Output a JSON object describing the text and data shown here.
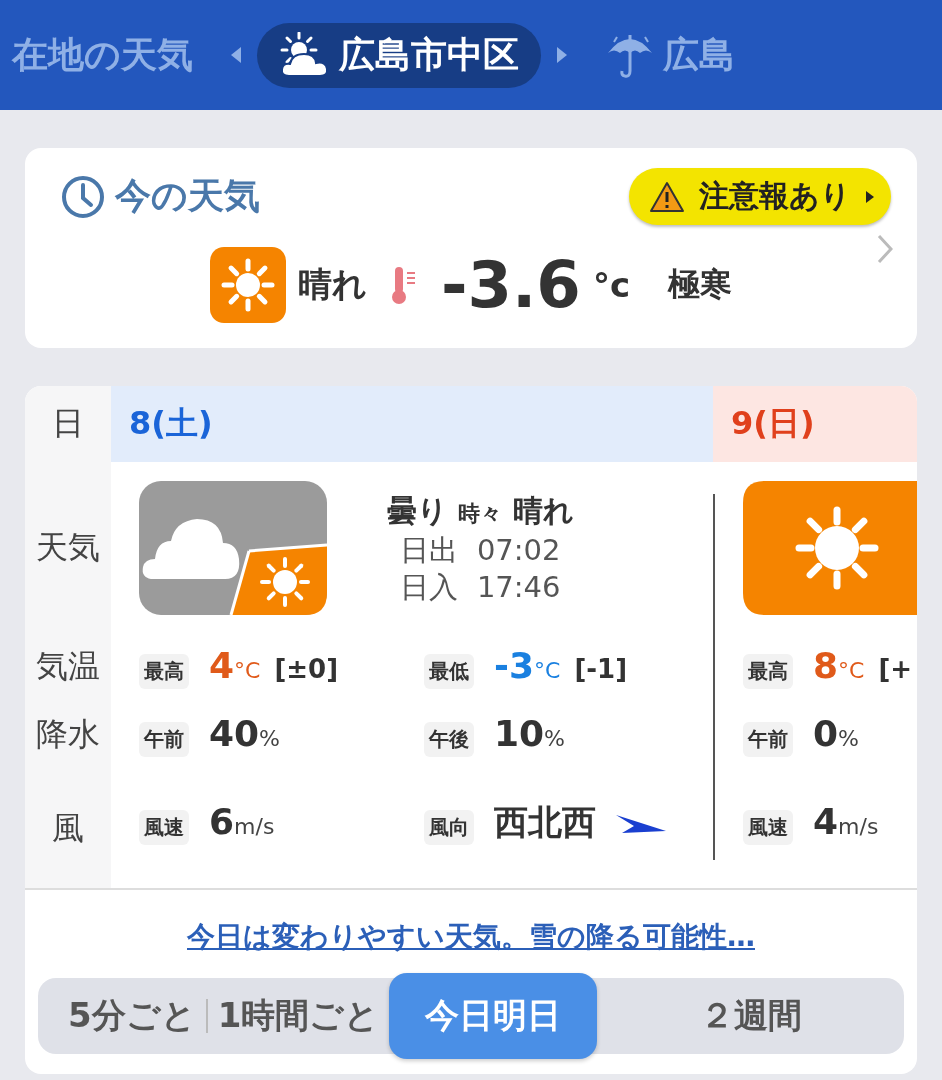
{
  "location_tabs": [
    {
      "label": "在地の天気",
      "kind": "plain",
      "selected": false
    },
    {
      "label": "広島市中区",
      "kind": "partly",
      "selected": true
    },
    {
      "label": "広島",
      "kind": "rain",
      "selected": false
    }
  ],
  "current": {
    "title": "今の天気",
    "alert": "注意報あり",
    "condition": "晴れ",
    "temperature": "-3.6",
    "unit": "°c",
    "feel": "極寒"
  },
  "forecast": {
    "row_labels": [
      "日",
      "天気",
      "気温",
      "降水",
      "風"
    ],
    "days": [
      {
        "date": "8(土)",
        "kind": "saturday",
        "condition": "曇り",
        "connector": "時々",
        "condition2": "晴れ",
        "sunrise_label": "日出",
        "sunrise": "07:02",
        "sunset_label": "日入",
        "sunset": "17:46",
        "temps": [
          {
            "label": "最高",
            "value": "4",
            "unit": "°C",
            "diff": "[±0]",
            "kind": "high"
          },
          {
            "label": "最低",
            "value": "-3",
            "unit": "°C",
            "diff": "[-1]",
            "kind": "low"
          }
        ],
        "precip": [
          {
            "label": "午前",
            "value": "40",
            "unit": "%"
          },
          {
            "label": "午後",
            "value": "10",
            "unit": "%"
          }
        ],
        "wind": [
          {
            "label": "風速",
            "value": "6",
            "unit": "m/s",
            "kind": "speed"
          },
          {
            "label": "風向",
            "value": "西北西",
            "kind": "direction"
          }
        ]
      },
      {
        "date": "9(日)",
        "kind": "sunday",
        "temps": [
          {
            "label": "最高",
            "value": "8",
            "unit": "°C",
            "diff": "[+",
            "kind": "high"
          }
        ],
        "precip": [
          {
            "label": "午前",
            "value": "0",
            "unit": "%"
          }
        ],
        "wind": [
          {
            "label": "風速",
            "value": "4",
            "unit": "m/s",
            "kind": "speed"
          }
        ]
      }
    ]
  },
  "summary_link": "今日は変わりやすい天気。雪の降る可能性…",
  "view_tabs": [
    {
      "label": "5分ごと",
      "selected": false
    },
    {
      "label": "1時間ごと",
      "selected": false
    },
    {
      "label": "今日明日",
      "selected": true
    },
    {
      "label": "２週間",
      "selected": false
    }
  ]
}
